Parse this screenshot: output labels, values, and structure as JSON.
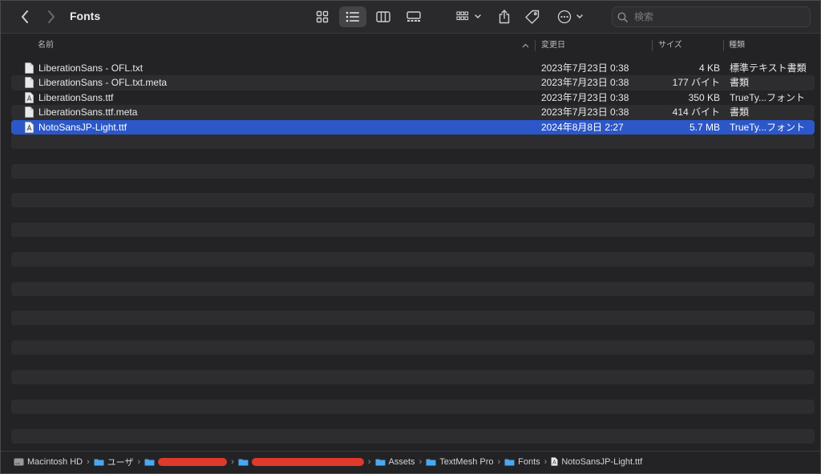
{
  "window": {
    "title": "Fonts"
  },
  "toolbar": {
    "search_placeholder": "検索",
    "icons": [
      "chevron-left-icon",
      "chevron-right-icon",
      "grid-view-icon",
      "list-view-icon",
      "column-view-icon",
      "gallery-view-icon",
      "group-icon",
      "share-icon",
      "tag-icon",
      "more-icon",
      "search-icon"
    ]
  },
  "columns": {
    "name": "名前",
    "date": "変更日",
    "size": "サイズ",
    "kind": "種類"
  },
  "files": [
    {
      "name": "LiberationSans - OFL.txt",
      "date": "2023年7月23日 0:38",
      "size": "4 KB",
      "kind": "標準テキスト書類",
      "icon": "document-icon"
    },
    {
      "name": "LiberationSans - OFL.txt.meta",
      "date": "2023年7月23日 0:38",
      "size": "177 バイト",
      "kind": "書類",
      "icon": "document-icon"
    },
    {
      "name": "LiberationSans.ttf",
      "date": "2023年7月23日 0:38",
      "size": "350 KB",
      "kind": "TrueTy...フォント",
      "icon": "font-file-icon"
    },
    {
      "name": "LiberationSans.ttf.meta",
      "date": "2023年7月23日 0:38",
      "size": "414 バイト",
      "kind": "書類",
      "icon": "document-icon"
    },
    {
      "name": "NotoSansJP-Light.ttf",
      "date": "2024年8月8日 2:27",
      "size": "5.7 MB",
      "kind": "TrueTy...フォント",
      "icon": "font-file-icon",
      "selected": true
    }
  ],
  "pathbar": {
    "items": [
      "Macintosh HD",
      "ユーザ",
      "",
      "",
      "Assets",
      "TextMesh Pro",
      "Fonts",
      "NotoSansJP-Light.ttf"
    ]
  },
  "colors": {
    "selection": "#2b57c8",
    "redaction": "#e03a2c",
    "folder": "#4aa8f0"
  }
}
